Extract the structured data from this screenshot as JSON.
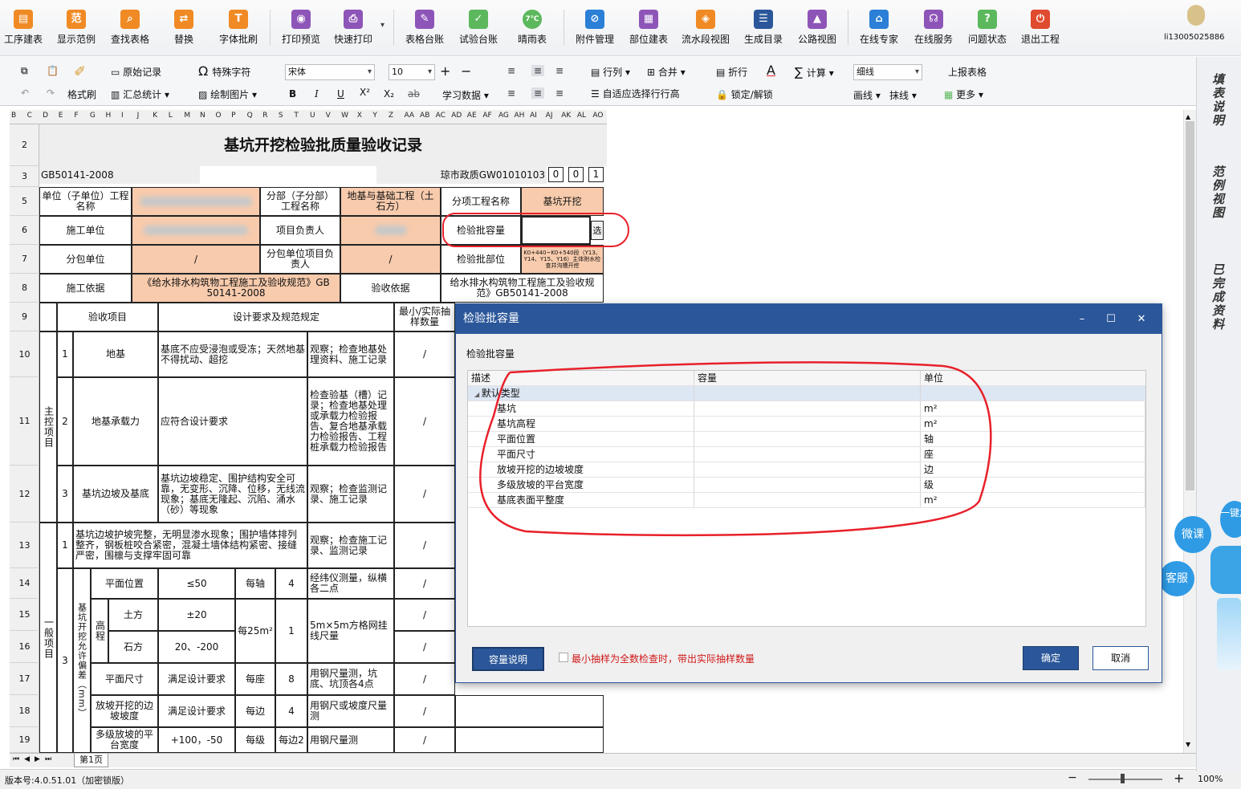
{
  "ribbon": {
    "buttons": [
      {
        "label": "工序建表",
        "icon": "layers-icon",
        "color": "#f08a24"
      },
      {
        "label": "显示范例",
        "icon": "example-icon",
        "color": "#f08a24"
      },
      {
        "label": "查找表格",
        "icon": "search-icon",
        "color": "#f08a24"
      },
      {
        "label": "替换",
        "icon": "replace-icon",
        "color": "#f08a24"
      },
      {
        "label": "字体批刷",
        "icon": "font-brush-icon",
        "color": "#f08a24"
      },
      {
        "label": "打印预览",
        "icon": "eye-icon",
        "color": "#8e55b8"
      },
      {
        "label": "快速打印",
        "icon": "printer-icon",
        "color": "#8e55b8"
      },
      {
        "label": "表格台账",
        "icon": "ledger-icon",
        "color": "#8e55b8"
      },
      {
        "label": "试验台账",
        "icon": "test-ledger-icon",
        "color": "#5cb85c"
      },
      {
        "label": "晴雨表",
        "icon": "weather-icon",
        "color": "#5cb85c"
      },
      {
        "label": "附件管理",
        "icon": "paperclip-icon",
        "color": "#2b7fd6"
      },
      {
        "label": "部位建表",
        "icon": "grid-icon",
        "color": "#8e55b8"
      },
      {
        "label": "流水段视图",
        "icon": "stack-icon",
        "color": "#f08a24"
      },
      {
        "label": "生成目录",
        "icon": "list-icon",
        "color": "#2b579a"
      },
      {
        "label": "公路视图",
        "icon": "road-icon",
        "color": "#8e55b8"
      },
      {
        "label": "在线专家",
        "icon": "expert-icon",
        "color": "#2b7fd6"
      },
      {
        "label": "在线服务",
        "icon": "headset-icon",
        "color": "#8e55b8"
      },
      {
        "label": "问题状态",
        "icon": "question-icon",
        "color": "#5cb85c"
      },
      {
        "label": "退出工程",
        "icon": "power-icon",
        "color": "#e04a2f"
      }
    ],
    "weather_temp": "7℃",
    "user": "li13005025886"
  },
  "toolbar": {
    "format_brush": "格式刷",
    "original_record": "原始记录",
    "summary_stats": "汇总统计",
    "special_char": "特殊字符",
    "draw_picture": "绘制图片",
    "font_name": "宋体",
    "font_size": "10",
    "study_data": "学习数据",
    "row_col": "行列",
    "merge": "合并",
    "wrap": "折行",
    "auto_row_height": "自适应选择行行高",
    "lock_unlock": "锁定/解锁",
    "calculate": "计算",
    "line_style": "细线",
    "draw_line": "画线",
    "erase_line": "抹线",
    "report_table": "上报表格",
    "more": "更多"
  },
  "columns": [
    "B",
    "C",
    "D",
    "E",
    "F",
    "G",
    "H",
    "I",
    "J",
    "K",
    "L",
    "M",
    "N",
    "O",
    "P",
    "Q",
    "R",
    "S",
    "T",
    "U",
    "V",
    "W",
    "X",
    "Y",
    "Z",
    "AA",
    "AB",
    "AC",
    "AD",
    "AE",
    "AF",
    "AG",
    "AH",
    "AI",
    "AJ",
    "AK",
    "AL",
    "AO"
  ],
  "rows": [
    "2",
    "3",
    "5",
    "6",
    "7",
    "8",
    "9",
    "10",
    "11",
    "12",
    "13",
    "14",
    "15",
    "16",
    "17",
    "18",
    "19"
  ],
  "sheet": {
    "title": "基坑开挖检验批质量验收记录",
    "std": "GB50141-2008",
    "code": "琼市政质GW01010103",
    "code_boxes": [
      "0",
      "0",
      "1"
    ],
    "unit_label": "单位（子单位）工程名称",
    "subdiv_label": "分部（子分部）工程名称",
    "subdiv_value": "地基与基础工程（土石方）",
    "item_label": "分项工程名称",
    "item_value": "基坑开挖",
    "contractor_label": "施工单位",
    "pm_label": "项目负责人",
    "capacity_label": "检验批容量",
    "select_btn": "选",
    "sub_contractor_label": "分包单位",
    "sub_contractor_value": "/",
    "sub_pm_label": "分包单位项目负责人",
    "sub_pm_value": "/",
    "part_label": "检验批部位",
    "part_value": "K0+440~K0+540段（Y13、Y14、Y15、Y16）主体附水检查井沟槽开挖",
    "basis_label": "施工依据",
    "basis_value": "《给水排水构筑物工程施工及验收规范》GB 50141-2008",
    "accept_label": "验收依据",
    "accept_value": "给水排水构筑物工程施工及验收规范》GB50141-2008",
    "hdr_item": "验收项目",
    "hdr_req": "设计要求及规范规定",
    "hdr_sample": "最小/实际抽样数量",
    "main_group": "主控项目",
    "general_group": "一般项目",
    "allow_group": "基坑开挖允许偏差（mm）",
    "r10": {
      "no": "1",
      "name": "地基",
      "req": "基底不应受浸泡或受冻；天然地基不得扰动、超挖",
      "check": "观察；检查地基处理资料、施工记录",
      "val": "/"
    },
    "r11": {
      "no": "2",
      "name": "地基承载力",
      "req": "应符合设计要求",
      "check": "检查验基（槽）记录；检查地基处理或承载力检验报告、复合地基承载力检验报告、工程桩承载力检验报告",
      "val": "/"
    },
    "r12": {
      "no": "3",
      "name": "基坑边坡及基底",
      "req": "基坑边坡稳定、围护结构安全可靠，无变形、沉降、位移，无线流现象；基底无隆起、沉陷、涌水（砂）等现象",
      "check": "观察；检查监测记录、施工记录",
      "val": "/"
    },
    "r13": {
      "no": "1",
      "req": "基坑边坡护坡完整，无明显渗水现象；围护墙体排列整齐，钢板桩咬合紧密，混凝土墙体结构紧密、接缝严密，围檩与支撑牢固可靠",
      "check": "观察；检查施工记录、监测记录",
      "val": "/"
    },
    "r14": {
      "name": "平面位置",
      "limit": "≤50",
      "range": "每轴",
      "pts": "4",
      "method": "经纬仪测量，纵横各二点",
      "val": "/"
    },
    "r15": {
      "grp": "高程",
      "name": "土方",
      "limit": "±20",
      "range": "每25m²",
      "pts": "1",
      "method": "5m×5m方格网挂线尺量",
      "val": "/"
    },
    "r16": {
      "name": "石方",
      "limit": "20、-200",
      "val": "/"
    },
    "r17": {
      "no": "3",
      "name": "平面尺寸",
      "limit": "满足设计要求",
      "range": "每座",
      "pts": "8",
      "method": "用钢尺量测，坑底、坑顶各4点",
      "val": "/"
    },
    "r18": {
      "name": "放坡开挖的边坡坡度",
      "limit": "满足设计要求",
      "range": "每边",
      "pts": "4",
      "method": "用钢尺或坡度尺量测",
      "val": "/"
    },
    "r19": {
      "name": "多级放坡的平台宽度",
      "limit": "+100，-50",
      "range": "每级",
      "pts": "每边2",
      "method": "用钢尺量测",
      "val": "/"
    }
  },
  "sheet_tab": "第1页",
  "status": {
    "version": "版本号:4.0.51.01（加密锁版）",
    "zoom": "100%"
  },
  "right_panel": [
    "填表说明",
    "范例视图",
    "已完成资料"
  ],
  "bubbles": {
    "weike": "微课",
    "kefu": "客服",
    "add": "一键加"
  },
  "dialog": {
    "title": "检验批容量",
    "section": "检验批容量",
    "columns": [
      "描述",
      "容量",
      "单位"
    ],
    "group": "默认类型",
    "rows": [
      {
        "desc": "基坑",
        "cap": "",
        "unit": "m²"
      },
      {
        "desc": "基坑高程",
        "cap": "",
        "unit": "m²"
      },
      {
        "desc": "平面位置",
        "cap": "",
        "unit": "轴"
      },
      {
        "desc": "平面尺寸",
        "cap": "",
        "unit": "座"
      },
      {
        "desc": "放坡开挖的边坡坡度",
        "cap": "",
        "unit": "边"
      },
      {
        "desc": "多级放坡的平台宽度",
        "cap": "",
        "unit": "级"
      },
      {
        "desc": "基底表面平整度",
        "cap": "",
        "unit": "m²"
      }
    ],
    "help_btn": "容量说明",
    "checkbox_label": "最小抽样为全数检查时，带出实际抽样数量",
    "ok": "确定",
    "cancel": "取消"
  },
  "colors": {
    "accent": "#2b579a",
    "salmon": "#f8cbad",
    "annotation": "#e8202a"
  }
}
